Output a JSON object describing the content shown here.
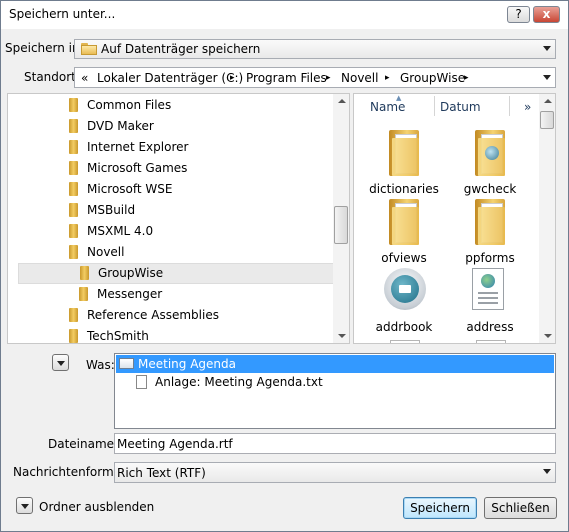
{
  "window": {
    "title": "Speichern unter..."
  },
  "title_buttons": {
    "help": "?",
    "close": "x"
  },
  "save_in": {
    "label": "Speichern in:",
    "value": "Auf Datenträger speichern"
  },
  "location": {
    "label": "Standort:",
    "prefix": "«",
    "crumbs": [
      "Lokaler Datenträger (C:)",
      "Program Files",
      "Novell",
      "GroupWise"
    ],
    "separator": "▸"
  },
  "tree": {
    "items": [
      {
        "label": "Common Files",
        "level": 0,
        "selected": false
      },
      {
        "label": "DVD Maker",
        "level": 0,
        "selected": false
      },
      {
        "label": "Internet Explorer",
        "level": 0,
        "selected": false
      },
      {
        "label": "Microsoft Games",
        "level": 0,
        "selected": false
      },
      {
        "label": "Microsoft WSE",
        "level": 0,
        "selected": false
      },
      {
        "label": "MSBuild",
        "level": 0,
        "selected": false
      },
      {
        "label": "MSXML 4.0",
        "level": 0,
        "selected": false
      },
      {
        "label": "Novell",
        "level": 0,
        "selected": false
      },
      {
        "label": "GroupWise",
        "level": 1,
        "selected": true
      },
      {
        "label": "Messenger",
        "level": 1,
        "selected": false
      },
      {
        "label": "Reference Assemblies",
        "level": 0,
        "selected": false
      },
      {
        "label": "TechSmith",
        "level": 0,
        "selected": false
      }
    ]
  },
  "files": {
    "columns": [
      "Name",
      "Datum"
    ],
    "more": "»",
    "items": [
      {
        "label": "dictionaries",
        "icon": "folder-icon"
      },
      {
        "label": "gwcheck",
        "icon": "folder-globe-icon"
      },
      {
        "label": "ofviews",
        "icon": "folder-icon"
      },
      {
        "label": "ppforms",
        "icon": "folder-icon"
      },
      {
        "label": "addrbook",
        "icon": "groupwise-app-icon"
      },
      {
        "label": "address",
        "icon": "document-globe-icon"
      }
    ]
  },
  "was": {
    "label": "Was:",
    "items": [
      "Meeting Agenda",
      "Anlage: Meeting Agenda.txt"
    ]
  },
  "filename": {
    "label": "Dateiname:",
    "value": "Meeting Agenda.rtf"
  },
  "format": {
    "label": "Nachrichtenformat:",
    "value": "Rich Text (RTF)"
  },
  "footer": {
    "hide_folders": "Ordner ausblenden",
    "save": "Speichern",
    "close": "Schließen"
  }
}
